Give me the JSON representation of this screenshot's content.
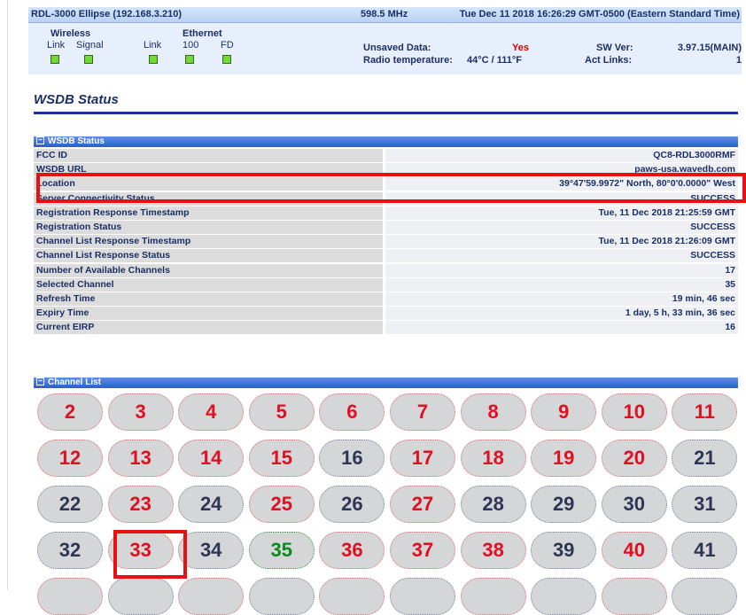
{
  "topbar": {
    "device": "RDL-3000 Ellipse (192.168.3.210)",
    "frequency": "598.5 MHz",
    "datetime": "Tue Dec 11 2018 16:26:29 GMT-0500 (Eastern Standard Time)"
  },
  "status": {
    "wireless_label": "Wireless",
    "wireless_link": "Link",
    "wireless_signal": "Signal",
    "ethernet_label": "Ethernet",
    "eth_link": "Link",
    "eth_100": "100",
    "eth_fd": "FD",
    "unsaved_label": "Unsaved Data:",
    "unsaved_value": "Yes",
    "radio_temp_label": "Radio temperature:",
    "radio_temp_value": "44°C / 111°F",
    "sw_ver_label": "SW Ver:",
    "sw_ver_value": "3.97.15(MAIN)",
    "act_links_label": "Act Links:",
    "act_links_value": "1",
    "led_color": "#73d936"
  },
  "page_title": "WSDB Status",
  "wsdb": {
    "section_title": "WSDB Status",
    "rows": [
      {
        "key": "FCC ID",
        "value": "QC8-RDL3000RMF"
      },
      {
        "key": "WSDB URL",
        "value": "paws-usa.wavedb.com"
      },
      {
        "key": "Location",
        "value": "39°47'59.9972\" North, 80°0'0.0000\" West"
      },
      {
        "key": "Server Connectivity Status",
        "value": "SUCCESS"
      },
      {
        "key": "Registration Response Timestamp",
        "value": "Tue, 11 Dec 2018 21:25:59 GMT"
      },
      {
        "key": "Registration Status",
        "value": "SUCCESS"
      },
      {
        "key": "Channel List Response Timestamp",
        "value": "Tue, 11 Dec 2018 21:26:09 GMT"
      },
      {
        "key": "Channel List Response Status",
        "value": "SUCCESS"
      },
      {
        "key": "Number of Available Channels",
        "value": "17"
      },
      {
        "key": "Selected Channel",
        "value": "35"
      },
      {
        "key": "Refresh Time",
        "value": "19 min, 46 sec"
      },
      {
        "key": "Expiry Time",
        "value": "1 day, 5 h, 33 min, 36 sec"
      },
      {
        "key": "Current EIRP",
        "value": "16"
      }
    ]
  },
  "channel_list": {
    "section_title": "Channel List",
    "colors": {
      "unavailable": "#e01020",
      "available": "#2f3556",
      "selected": "#0b8a1a"
    },
    "channels": [
      {
        "number": "2",
        "state": "red"
      },
      {
        "number": "3",
        "state": "red"
      },
      {
        "number": "4",
        "state": "red"
      },
      {
        "number": "5",
        "state": "red"
      },
      {
        "number": "6",
        "state": "red"
      },
      {
        "number": "7",
        "state": "red"
      },
      {
        "number": "8",
        "state": "red"
      },
      {
        "number": "9",
        "state": "red"
      },
      {
        "number": "10",
        "state": "red"
      },
      {
        "number": "11",
        "state": "red"
      },
      {
        "number": "12",
        "state": "red"
      },
      {
        "number": "13",
        "state": "red"
      },
      {
        "number": "14",
        "state": "red"
      },
      {
        "number": "15",
        "state": "red"
      },
      {
        "number": "16",
        "state": "navy"
      },
      {
        "number": "17",
        "state": "red"
      },
      {
        "number": "18",
        "state": "red"
      },
      {
        "number": "19",
        "state": "red"
      },
      {
        "number": "20",
        "state": "red"
      },
      {
        "number": "21",
        "state": "navy"
      },
      {
        "number": "22",
        "state": "navy"
      },
      {
        "number": "23",
        "state": "red"
      },
      {
        "number": "24",
        "state": "navy"
      },
      {
        "number": "25",
        "state": "red"
      },
      {
        "number": "26",
        "state": "navy"
      },
      {
        "number": "27",
        "state": "red"
      },
      {
        "number": "28",
        "state": "navy"
      },
      {
        "number": "29",
        "state": "navy"
      },
      {
        "number": "30",
        "state": "navy"
      },
      {
        "number": "31",
        "state": "navy"
      },
      {
        "number": "32",
        "state": "navy"
      },
      {
        "number": "33",
        "state": "red"
      },
      {
        "number": "34",
        "state": "navy"
      },
      {
        "number": "35",
        "state": "green"
      },
      {
        "number": "36",
        "state": "red"
      },
      {
        "number": "37",
        "state": "red"
      },
      {
        "number": "38",
        "state": "red"
      },
      {
        "number": "39",
        "state": "navy"
      },
      {
        "number": "40",
        "state": "red"
      },
      {
        "number": "41",
        "state": "navy"
      }
    ]
  }
}
